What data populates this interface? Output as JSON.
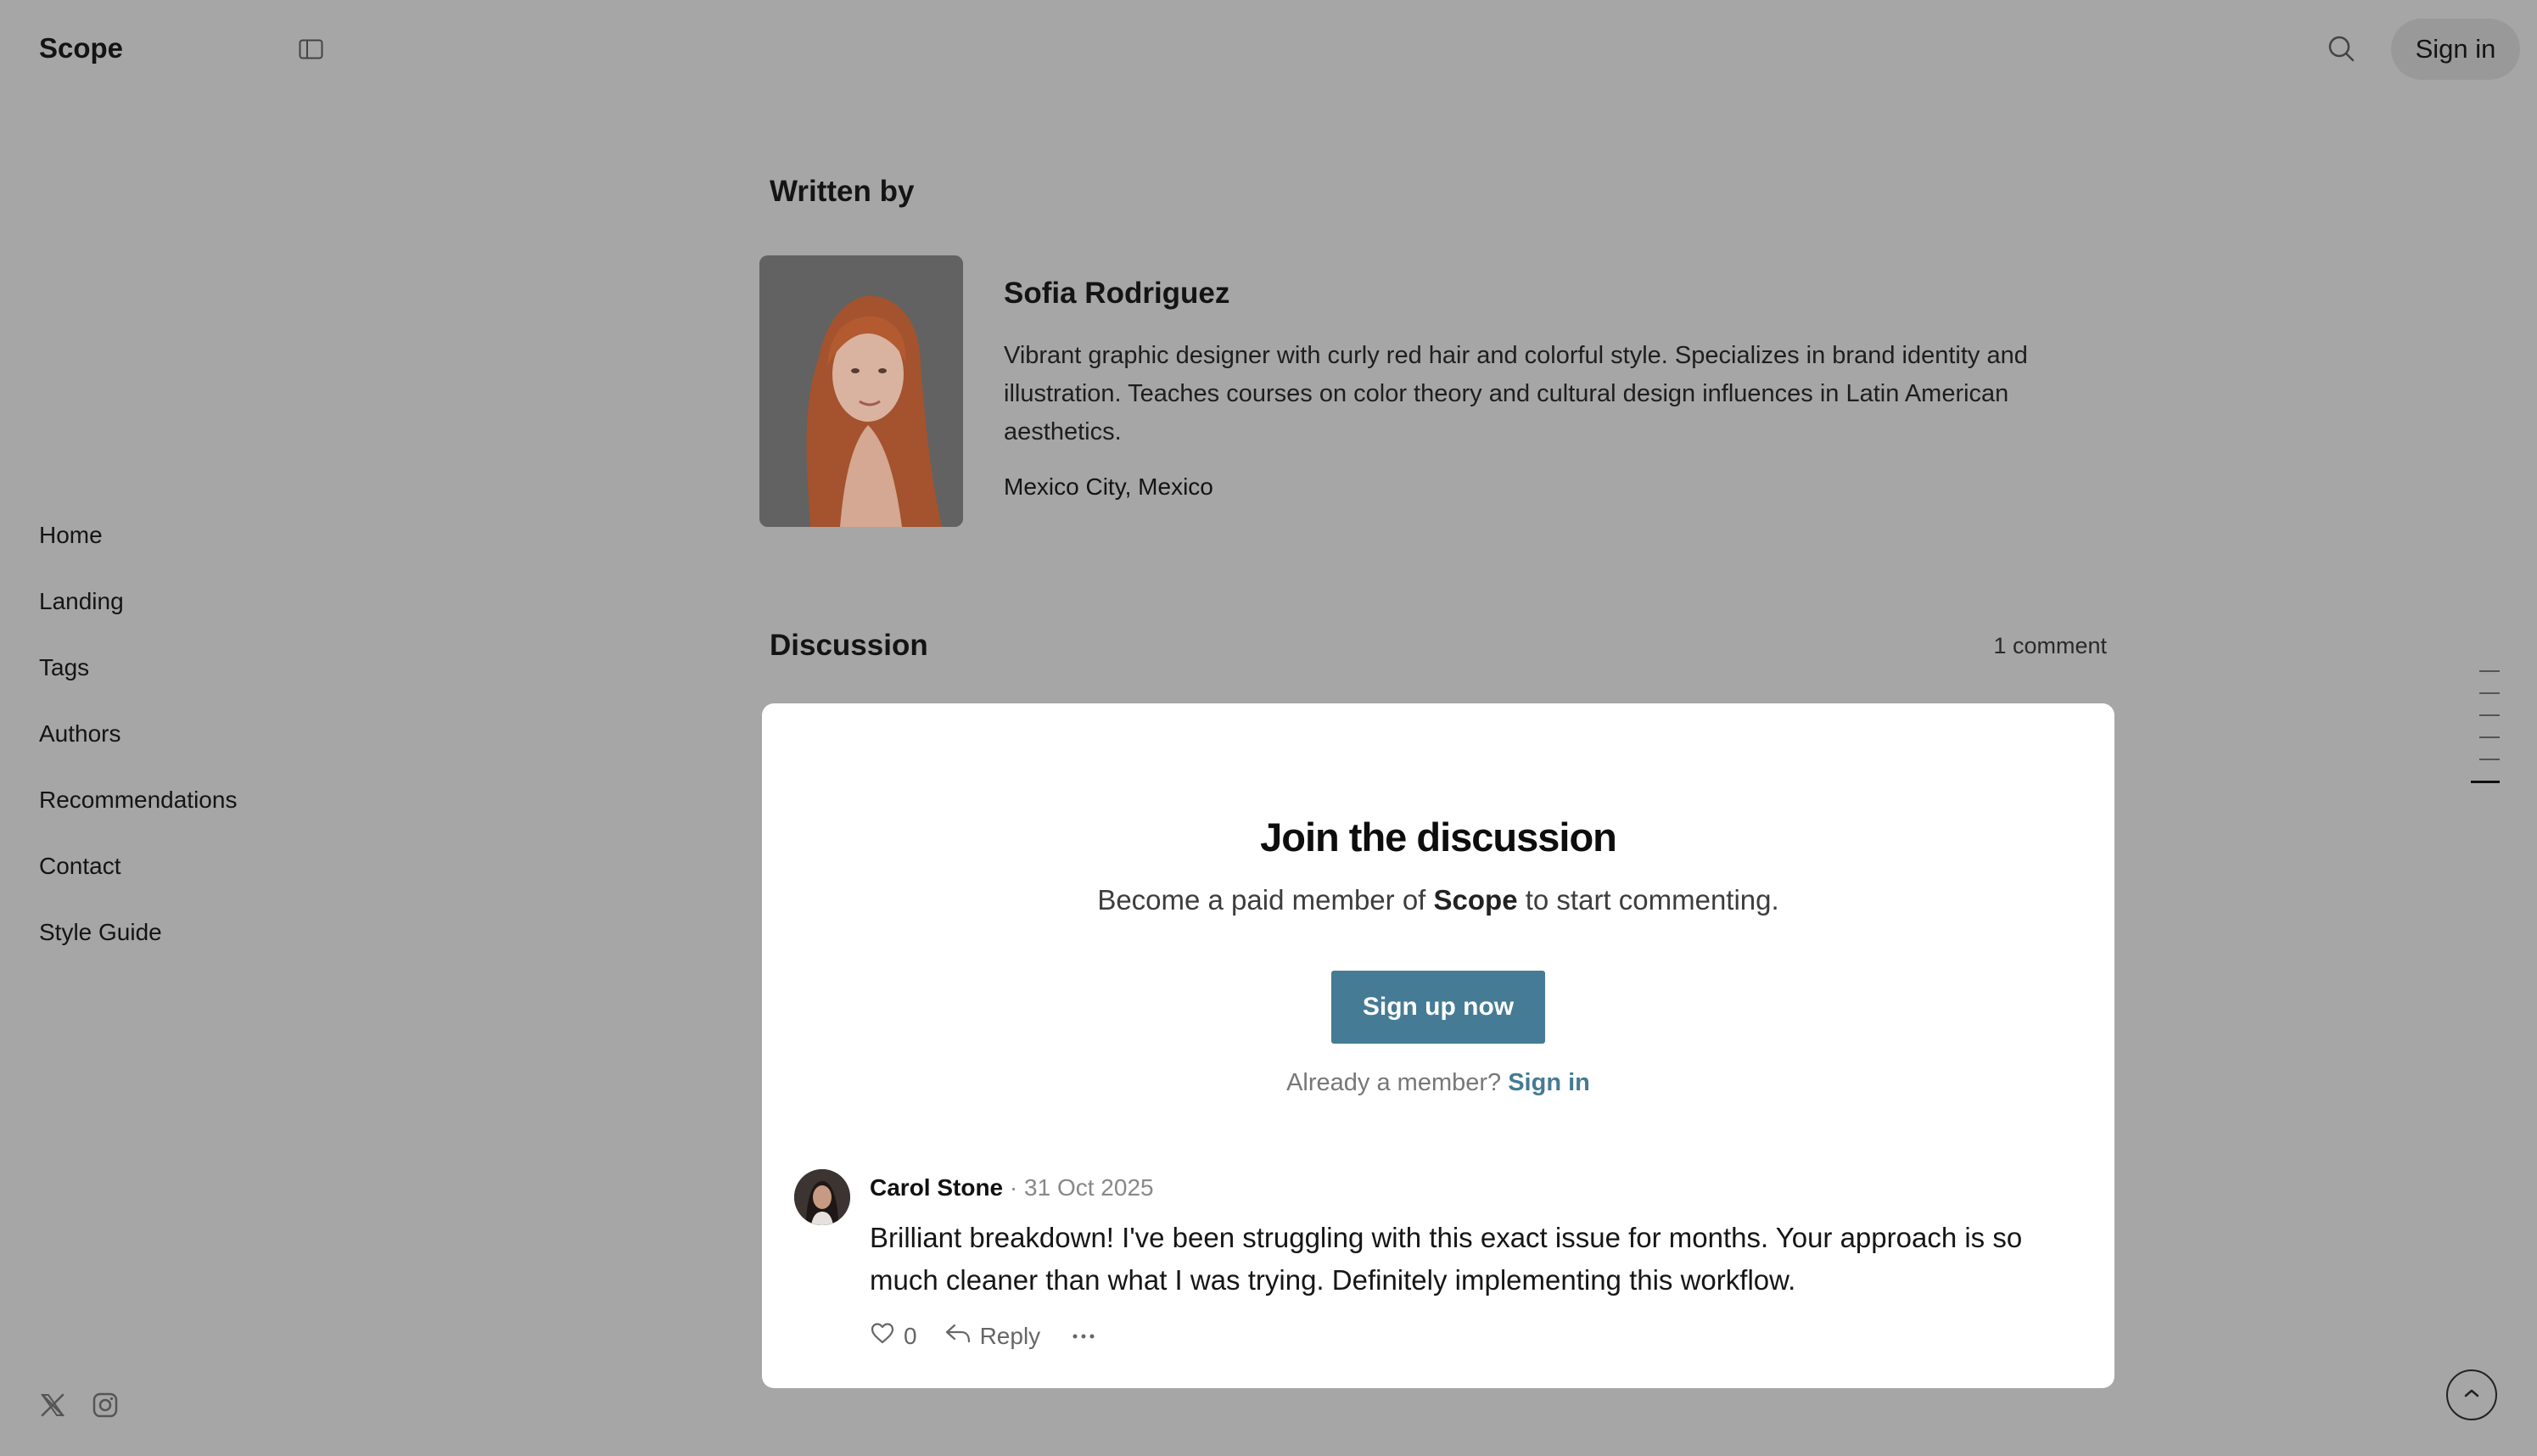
{
  "header": {
    "brand": "Scope",
    "sign_in_label": "Sign in"
  },
  "sidebar": {
    "items": [
      {
        "label": "Home"
      },
      {
        "label": "Landing"
      },
      {
        "label": "Tags"
      },
      {
        "label": "Authors"
      },
      {
        "label": "Recommendations"
      },
      {
        "label": "Contact"
      },
      {
        "label": "Style Guide"
      }
    ],
    "social": [
      "x-icon",
      "instagram-icon"
    ]
  },
  "author": {
    "section_title": "Written by",
    "name": "Sofia Rodriguez",
    "bio": "Vibrant graphic designer with curly red hair and colorful style. Specializes in brand identity and illustration. Teaches courses on color theory and cultural design influences in Latin American aesthetics.",
    "location": "Mexico City, Mexico"
  },
  "discussion": {
    "title": "Discussion",
    "count_label": "1 comment",
    "cta": {
      "title": "Join the discussion",
      "text_before": "Become a paid member of ",
      "brand": "Scope",
      "text_after": " to start commenting.",
      "signup_label": "Sign up now",
      "member_prompt": "Already a member? ",
      "member_signin": "Sign in"
    },
    "comments": [
      {
        "author": "Carol Stone",
        "separator": " · ",
        "date": "31 Oct 2025",
        "body": "Brilliant breakdown! I've been struggling with this exact issue for months. Your approach is so much cleaner than what I was trying. Definitely implementing this workflow.",
        "likes": "0",
        "reply_label": "Reply"
      }
    ]
  },
  "colors": {
    "background": "#a6a6a6",
    "accent": "#457b94",
    "card": "#ffffff"
  },
  "toc_ticks": 6
}
